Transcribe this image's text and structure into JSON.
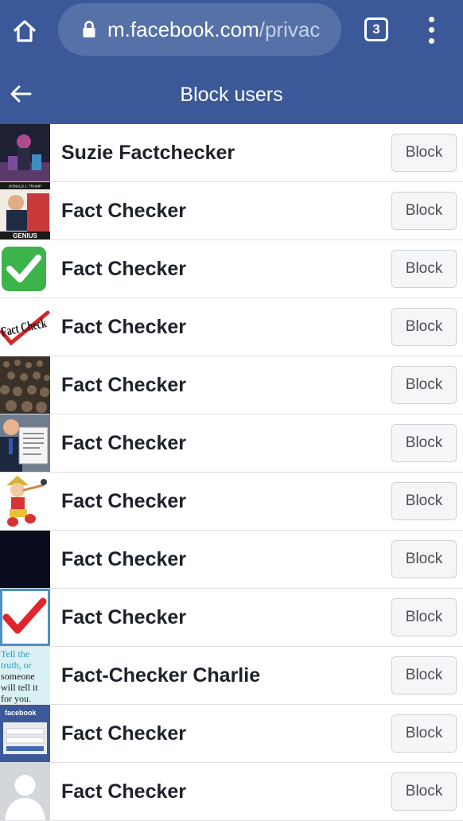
{
  "browser": {
    "url_host": "m.facebook.com",
    "url_path": "/privac",
    "tab_count": "3"
  },
  "header": {
    "title": "Block users"
  },
  "users": [
    {
      "name": "Suzie Factchecker",
      "block_label": "Block",
      "avatar_icon": "dark-character-avatar"
    },
    {
      "name": "Fact Checker",
      "block_label": "Block",
      "avatar_icon": "donald-trump-book-cover-avatar",
      "avatar_text_top": "DONALD J. TRUMP",
      "avatar_text_bottom": "GENIUS"
    },
    {
      "name": "Fact Checker",
      "block_label": "Block",
      "avatar_icon": "green-checkmark-avatar"
    },
    {
      "name": "Fact Checker",
      "block_label": "Block",
      "avatar_icon": "fact-check-stamp-avatar",
      "avatar_text": "Fact Check"
    },
    {
      "name": "Fact Checker",
      "block_label": "Block",
      "avatar_icon": "crowd-photo-avatar"
    },
    {
      "name": "Fact Checker",
      "block_label": "Block",
      "avatar_icon": "man-holding-document-avatar"
    },
    {
      "name": "Fact Checker",
      "block_label": "Block",
      "avatar_icon": "pinocchio-avatar"
    },
    {
      "name": "Fact Checker",
      "block_label": "Block",
      "avatar_icon": "dark-navy-avatar"
    },
    {
      "name": "Fact Checker",
      "block_label": "Block",
      "avatar_icon": "red-checkmark-avatar"
    },
    {
      "name": "Fact-Checker Charlie",
      "block_label": "Block",
      "avatar_icon": "tell-the-truth-text-avatar",
      "avatar_text_lines": [
        "Tell the",
        "truth, or",
        "someone",
        "will tell it",
        "for you."
      ]
    },
    {
      "name": "Fact Checker",
      "block_label": "Block",
      "avatar_icon": "facebook-login-screenshot-avatar",
      "avatar_text": "facebook"
    },
    {
      "name": "Fact Checker",
      "block_label": "Block",
      "avatar_icon": "default-silhouette-avatar"
    }
  ],
  "colors": {
    "brand": "#3b5998",
    "url_pill": "#5671a8",
    "button_bg": "#f5f6f7",
    "divider": "#dddfe2"
  }
}
